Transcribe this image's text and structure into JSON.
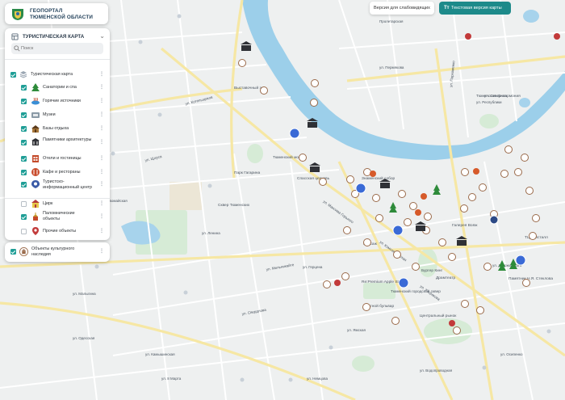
{
  "app": {
    "title_line1": "ГЕОПОРТАЛ",
    "title_line2": "ТЮМЕНСКОЙ ОБЛАСТИ"
  },
  "toolbar": {
    "low_vision_label": "Версия для слабовидящих",
    "text_version_icon": "Тт",
    "text_version_label": "Текстовая версия карты"
  },
  "layers_panel": {
    "header": "ТУРИСТИЧЕСКАЯ КАРТА",
    "search_placeholder": "Поиск",
    "group_label": "Туристическая карта",
    "items": [
      {
        "label": "Санатории и спа",
        "checked": true,
        "icon": "tree-icon",
        "color": "#2e8b3a"
      },
      {
        "label": "Горячие источники",
        "checked": true,
        "icon": "hot-spring-icon",
        "color": "#3a8fd6"
      },
      {
        "label": "Музеи",
        "checked": true,
        "icon": "museum-icon",
        "color": "#7a5a3a"
      },
      {
        "label": "Базы отдыха",
        "checked": true,
        "icon": "lodge-icon",
        "color": "#8a6a3a"
      },
      {
        "label": "Памятники архитектуры",
        "checked": true,
        "icon": "monument-icon",
        "color": "#333333"
      },
      {
        "label": "Отели и гостиницы",
        "checked": true,
        "icon": "hotel-icon",
        "color": "#c44a2a"
      },
      {
        "label": "Кафе и рестораны",
        "checked": true,
        "icon": "cafe-icon",
        "color": "#c84a2a"
      },
      {
        "label": "Туристско-информационный центр",
        "checked": true,
        "icon": "info-center-icon",
        "color": "#3a5aa6"
      },
      {
        "label": "Цирк",
        "checked": false,
        "icon": "circus-icon",
        "color": "#b23a3a"
      },
      {
        "label": "Паломнические объекты",
        "checked": true,
        "icon": "church-icon",
        "color": "#c49a2a"
      },
      {
        "label": "Прочие объекты",
        "checked": false,
        "icon": "location-pin-icon",
        "color": "#c23a3a"
      }
    ]
  },
  "heritage_layer": {
    "label": "Объекты культурного наследия",
    "checked": true,
    "icon": "heritage-icon"
  },
  "map": {
    "street_labels": [
      "Бизнес-центр",
      "Пролетарская",
      "ул. Пархоменко",
      "ул. Республики",
      "ул. Ленина",
      "ул. Мельникайте",
      "ул. Свердлова",
      "ул. Ямская",
      "ул. Камышинская",
      "ул. Малыгина",
      "ул. Щорса",
      "ул. Герцена",
      "ул. Котельщиков",
      "ул. Северная",
      "ул. Водопроводная",
      "ул. Осипенко",
      "ул. Пермякова",
      "ул. Одесская",
      "ул. Максима Горького",
      "ул. Хохрякова",
      "ул. Немцова",
      "ул. Дзержинского",
      "ул. 8 Марта",
      "ул. Комсомольская",
      "ул. Первомайская"
    ],
    "poi_labels": [
      "Тюменский мост",
      "Спасская церковь",
      "Знаменский собор",
      "Сквер Тюменских",
      "Цветной бульвар",
      "Центральный рынок",
      "Пассаж",
      "Драмтеатр",
      "Re:Premium Apple Store",
      "Тюменский городской сквер",
      "Бургер Кинг",
      "Галерея Вояж",
      "Памятник Н.Я. Стеклова",
      "ТЦ Кристалл",
      "Тюменская филармония",
      "Выставочный зал",
      "Парк Гагарина",
      "Стадион Геолог"
    ]
  }
}
